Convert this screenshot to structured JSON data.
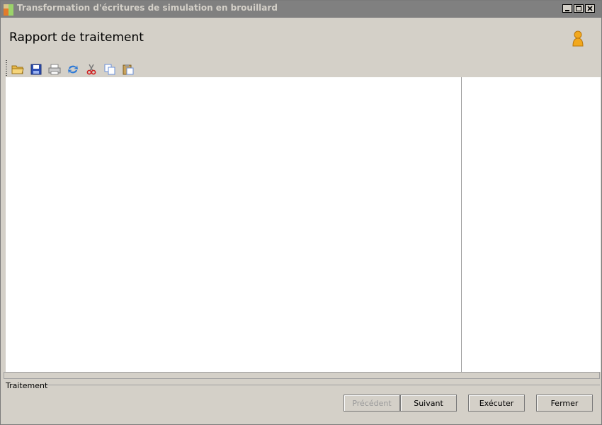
{
  "window": {
    "title": "Transformation d'écritures de simulation en brouillard"
  },
  "header": {
    "title": "Rapport de traitement",
    "user_icon": "user-icon"
  },
  "toolbar": {
    "items": [
      {
        "icon": "folder-open-icon"
      },
      {
        "icon": "save-icon"
      },
      {
        "icon": "print-icon"
      },
      {
        "icon": "refresh-icon"
      },
      {
        "icon": "cut-icon"
      },
      {
        "icon": "copy-icon"
      },
      {
        "icon": "paste-icon"
      }
    ]
  },
  "status": {
    "label": "Traitement"
  },
  "buttons": {
    "previous": "Précédent",
    "next": "Suivant",
    "execute": "Exécuter",
    "close": "Fermer"
  },
  "colors": {
    "titlebar": "#808080",
    "background": "#d4d0c8",
    "content": "#ffffff"
  }
}
